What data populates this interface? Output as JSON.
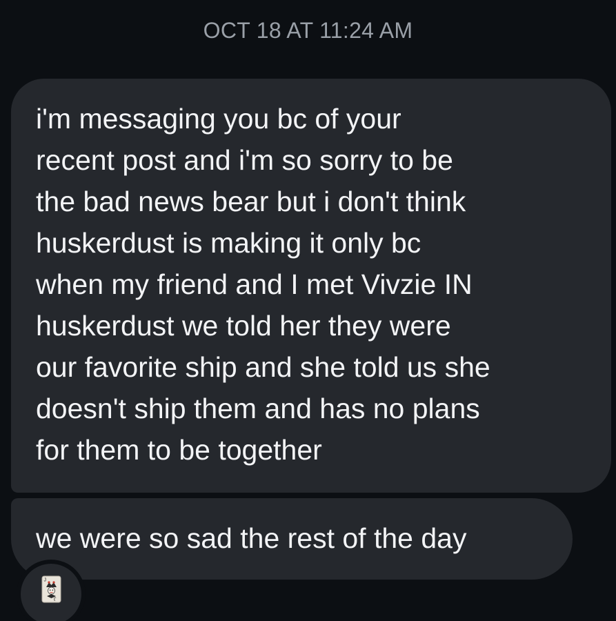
{
  "thread": {
    "timestamp": "OCT 18 AT 11:24 AM"
  },
  "messages": [
    {
      "lines": [
        "i'm messaging you bc of your",
        "recent post and i'm so sorry to be",
        "the bad news bear but i don't think",
        "huskerdust is making it only bc",
        "when my friend and I met Vivzie IN",
        "huskerdust we told her they were",
        "our favorite ship and she told us she",
        "doesn't ship them and has no plans",
        "for them to be together"
      ]
    },
    {
      "text": "we were so sad the rest of the day"
    }
  ],
  "sender": {
    "avatar_icon": "joker-card-icon"
  },
  "colors": {
    "background": "#0c0f13",
    "bubble": "#25282d",
    "text": "#f3f4f6",
    "timestamp": "#9aa0a8"
  }
}
